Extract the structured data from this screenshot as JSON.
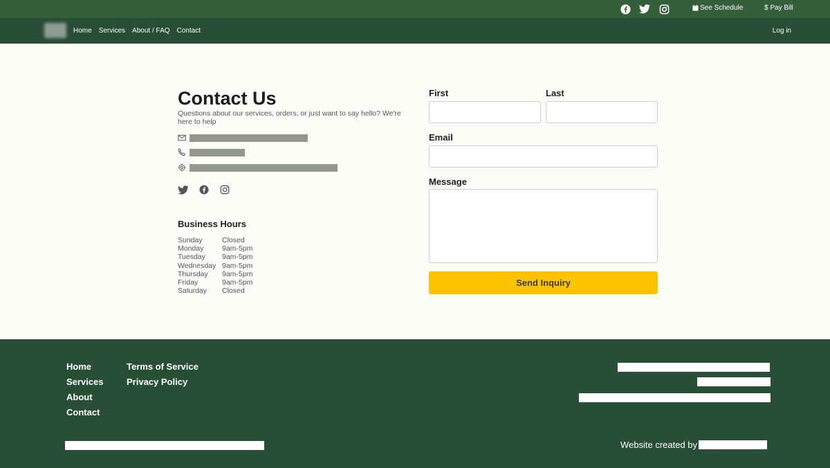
{
  "topbar": {
    "social_icons": [
      "facebook-icon",
      "twitter-icon",
      "instagram-icon"
    ],
    "see_schedule": "See Schedule",
    "pay_bill": "$ Pay Bill"
  },
  "nav": {
    "items": [
      "Home",
      "Services",
      "About / FAQ",
      "Contact"
    ],
    "login": "Log in"
  },
  "contact": {
    "title": "Contact Us",
    "subtitle": "Questions about our services, orders, or just want to say hello? We're here to help",
    "info_icons": [
      "mail-icon",
      "phone-icon",
      "location-icon"
    ],
    "social_icons": [
      "twitter-icon",
      "facebook-icon",
      "instagram-icon"
    ]
  },
  "hours": {
    "title": "Business Hours",
    "days": [
      {
        "day": "Sunday",
        "time": "Closed"
      },
      {
        "day": "Monday",
        "time": "9am-5pm"
      },
      {
        "day": "Tuesday",
        "time": "9am-5pm"
      },
      {
        "day": "Wednesday",
        "time": "9am-5pm"
      },
      {
        "day": "Thursday",
        "time": "9am-5pm"
      },
      {
        "day": "Friday",
        "time": "9am-5pm"
      },
      {
        "day": "Saturday",
        "time": "Closed"
      }
    ]
  },
  "form": {
    "first_label": "First",
    "last_label": "Last",
    "email_label": "Email",
    "message_label": "Message",
    "first_value": "",
    "last_value": "",
    "email_value": "",
    "message_value": "",
    "submit": "Send Inquiry"
  },
  "footer": {
    "col1": [
      "Home",
      "Services",
      "About",
      "Contact"
    ],
    "col2": [
      "Terms of Service",
      "Privacy Policy"
    ],
    "credit": "Website created by"
  },
  "colors": {
    "topbar": "#355e3a",
    "navbar": "#284e37",
    "footer": "#284e37",
    "accent": "#fdc300",
    "background": "#fdfdf8"
  }
}
